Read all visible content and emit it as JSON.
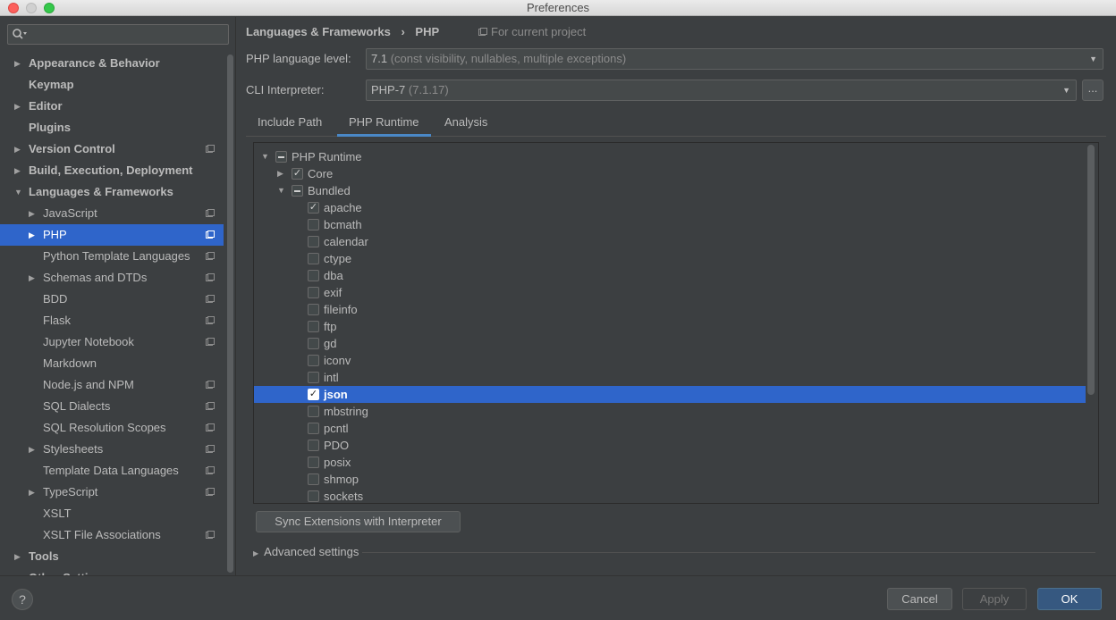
{
  "window": {
    "title": "Preferences"
  },
  "colors": {
    "selection": "#2f65ca",
    "accent": "#4a88c7",
    "background": "#3c3f41",
    "ok_button": "#365880"
  },
  "sidebar": {
    "search": {
      "icon": "search-icon",
      "value": ""
    },
    "items": [
      {
        "label": "Appearance & Behavior",
        "level": 0,
        "expander": "collapsed",
        "bold": true,
        "project": false,
        "selected": false
      },
      {
        "label": "Keymap",
        "level": 0,
        "expander": "none",
        "bold": true,
        "project": false,
        "selected": false
      },
      {
        "label": "Editor",
        "level": 0,
        "expander": "collapsed",
        "bold": true,
        "project": false,
        "selected": false
      },
      {
        "label": "Plugins",
        "level": 0,
        "expander": "none",
        "bold": true,
        "project": false,
        "selected": false
      },
      {
        "label": "Version Control",
        "level": 0,
        "expander": "collapsed",
        "bold": true,
        "project": true,
        "selected": false
      },
      {
        "label": "Build, Execution, Deployment",
        "level": 0,
        "expander": "collapsed",
        "bold": true,
        "project": false,
        "selected": false
      },
      {
        "label": "Languages & Frameworks",
        "level": 0,
        "expander": "expanded",
        "bold": true,
        "project": false,
        "selected": false
      },
      {
        "label": "JavaScript",
        "level": 1,
        "expander": "collapsed",
        "bold": false,
        "project": true,
        "selected": false
      },
      {
        "label": "PHP",
        "level": 1,
        "expander": "collapsed",
        "bold": false,
        "project": true,
        "selected": true
      },
      {
        "label": "Python Template Languages",
        "level": 1,
        "expander": "none",
        "bold": false,
        "project": true,
        "selected": false
      },
      {
        "label": "Schemas and DTDs",
        "level": 1,
        "expander": "collapsed",
        "bold": false,
        "project": true,
        "selected": false
      },
      {
        "label": "BDD",
        "level": 1,
        "expander": "none",
        "bold": false,
        "project": true,
        "selected": false
      },
      {
        "label": "Flask",
        "level": 1,
        "expander": "none",
        "bold": false,
        "project": true,
        "selected": false
      },
      {
        "label": "Jupyter Notebook",
        "level": 1,
        "expander": "none",
        "bold": false,
        "project": true,
        "selected": false
      },
      {
        "label": "Markdown",
        "level": 1,
        "expander": "none",
        "bold": false,
        "project": false,
        "selected": false
      },
      {
        "label": "Node.js and NPM",
        "level": 1,
        "expander": "none",
        "bold": false,
        "project": true,
        "selected": false
      },
      {
        "label": "SQL Dialects",
        "level": 1,
        "expander": "none",
        "bold": false,
        "project": true,
        "selected": false
      },
      {
        "label": "SQL Resolution Scopes",
        "level": 1,
        "expander": "none",
        "bold": false,
        "project": true,
        "selected": false
      },
      {
        "label": "Stylesheets",
        "level": 1,
        "expander": "collapsed",
        "bold": false,
        "project": true,
        "selected": false
      },
      {
        "label": "Template Data Languages",
        "level": 1,
        "expander": "none",
        "bold": false,
        "project": true,
        "selected": false
      },
      {
        "label": "TypeScript",
        "level": 1,
        "expander": "collapsed",
        "bold": false,
        "project": true,
        "selected": false
      },
      {
        "label": "XSLT",
        "level": 1,
        "expander": "none",
        "bold": false,
        "project": false,
        "selected": false
      },
      {
        "label": "XSLT File Associations",
        "level": 1,
        "expander": "none",
        "bold": false,
        "project": true,
        "selected": false
      },
      {
        "label": "Tools",
        "level": 0,
        "expander": "collapsed",
        "bold": true,
        "project": false,
        "selected": false
      },
      {
        "label": "Other Settings",
        "level": 0,
        "expander": "collapsed",
        "bold": true,
        "project": false,
        "selected": false
      }
    ]
  },
  "main": {
    "breadcrumb": {
      "parent": "Languages & Frameworks",
      "separator": "›",
      "current": "PHP"
    },
    "for_project": "For current project",
    "language_level": {
      "label": "PHP language level:",
      "value": "7.1",
      "hint": "(const visibility, nullables, multiple exceptions)"
    },
    "cli": {
      "label": "CLI Interpreter:",
      "value": "PHP-7",
      "hint": "(7.1.17)",
      "more_label": "..."
    },
    "tabs": [
      {
        "label": "Include Path",
        "active": false
      },
      {
        "label": "PHP Runtime",
        "active": true
      },
      {
        "label": "Analysis",
        "active": false
      }
    ],
    "runtime_tree": [
      {
        "label": "PHP Runtime",
        "level": 0,
        "expander": "expanded",
        "state": "partial",
        "selected": false
      },
      {
        "label": "Core",
        "level": 1,
        "expander": "collapsed",
        "state": "checked",
        "selected": false
      },
      {
        "label": "Bundled",
        "level": 1,
        "expander": "expanded",
        "state": "partial",
        "selected": false
      },
      {
        "label": "apache",
        "level": 2,
        "expander": "none",
        "state": "checked",
        "selected": false
      },
      {
        "label": "bcmath",
        "level": 2,
        "expander": "none",
        "state": "unchecked",
        "selected": false
      },
      {
        "label": "calendar",
        "level": 2,
        "expander": "none",
        "state": "unchecked",
        "selected": false
      },
      {
        "label": "ctype",
        "level": 2,
        "expander": "none",
        "state": "unchecked",
        "selected": false
      },
      {
        "label": "dba",
        "level": 2,
        "expander": "none",
        "state": "unchecked",
        "selected": false
      },
      {
        "label": "exif",
        "level": 2,
        "expander": "none",
        "state": "unchecked",
        "selected": false
      },
      {
        "label": "fileinfo",
        "level": 2,
        "expander": "none",
        "state": "unchecked",
        "selected": false
      },
      {
        "label": "ftp",
        "level": 2,
        "expander": "none",
        "state": "unchecked",
        "selected": false
      },
      {
        "label": "gd",
        "level": 2,
        "expander": "none",
        "state": "unchecked",
        "selected": false
      },
      {
        "label": "iconv",
        "level": 2,
        "expander": "none",
        "state": "unchecked",
        "selected": false
      },
      {
        "label": "intl",
        "level": 2,
        "expander": "none",
        "state": "unchecked",
        "selected": false
      },
      {
        "label": "json",
        "level": 2,
        "expander": "none",
        "state": "checked",
        "selected": true
      },
      {
        "label": "mbstring",
        "level": 2,
        "expander": "none",
        "state": "unchecked",
        "selected": false
      },
      {
        "label": "pcntl",
        "level": 2,
        "expander": "none",
        "state": "unchecked",
        "selected": false
      },
      {
        "label": "PDO",
        "level": 2,
        "expander": "none",
        "state": "unchecked",
        "selected": false
      },
      {
        "label": "posix",
        "level": 2,
        "expander": "none",
        "state": "unchecked",
        "selected": false
      },
      {
        "label": "shmop",
        "level": 2,
        "expander": "none",
        "state": "unchecked",
        "selected": false
      },
      {
        "label": "sockets",
        "level": 2,
        "expander": "none",
        "state": "unchecked",
        "selected": false
      }
    ],
    "sync_button": "Sync Extensions with Interpreter",
    "advanced_settings": "Advanced settings"
  },
  "footer": {
    "help_label": "?",
    "cancel_label": "Cancel",
    "apply_label": "Apply",
    "ok_label": "OK"
  }
}
